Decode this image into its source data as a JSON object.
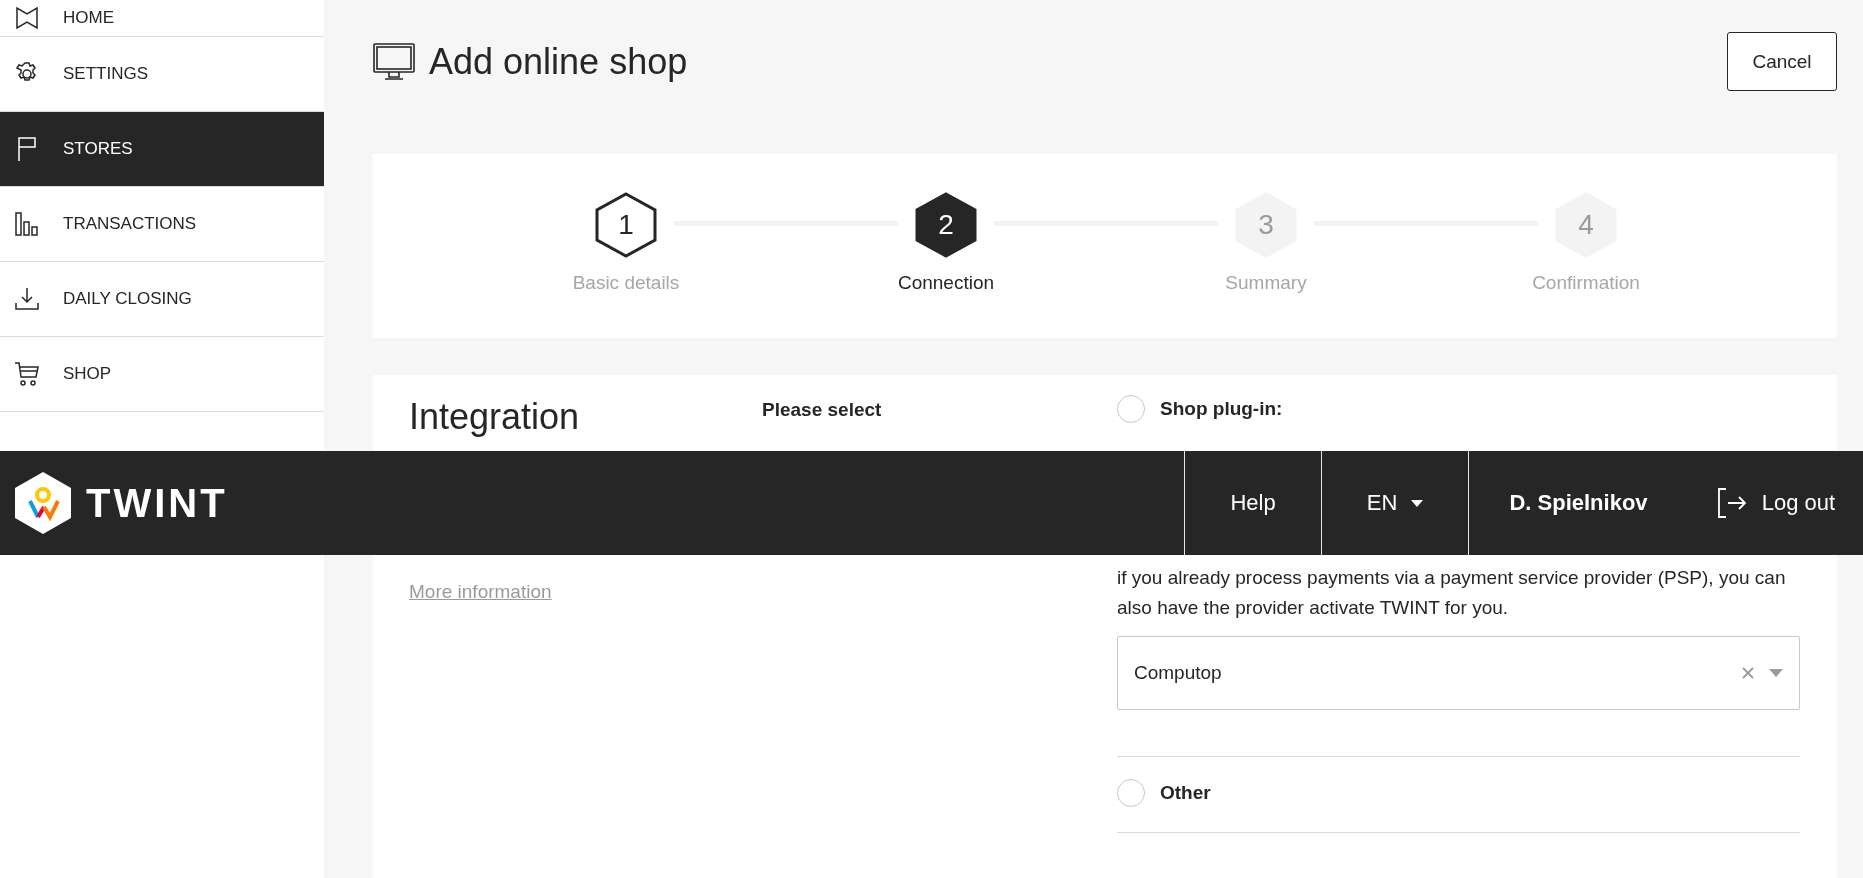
{
  "sidebar": {
    "items": [
      {
        "label": "HOME",
        "selected": false
      },
      {
        "label": "SETTINGS",
        "selected": false
      },
      {
        "label": "STORES",
        "selected": true
      },
      {
        "label": "TRANSACTIONS",
        "selected": false
      },
      {
        "label": "DAILY CLOSING",
        "selected": false
      },
      {
        "label": "SHOP",
        "selected": false
      }
    ]
  },
  "page": {
    "title": "Add online shop",
    "cancel": "Cancel"
  },
  "steps": [
    {
      "number": "1",
      "label": "Basic details",
      "done": true,
      "selected": false
    },
    {
      "number": "2",
      "label": "Connection",
      "done": false,
      "selected": true
    },
    {
      "number": "3",
      "label": "Summary",
      "done": false,
      "selected": false
    },
    {
      "number": "4",
      "label": "Confirmation",
      "done": false,
      "selected": false
    }
  ],
  "integration": {
    "title": "Integration",
    "more_link": "More information",
    "prompt": "Please select",
    "options": [
      {
        "label": "Shop plug-in:",
        "selected": false,
        "description": "if you already process payments via a payment service provider (PSP), you can also have the provider activate TWINT for you.",
        "select_value": "Computop"
      },
      {
        "label": "Other",
        "selected": false
      }
    ]
  },
  "header": {
    "logo_text": "TWINT",
    "help": "Help",
    "language": "EN",
    "user": "D. Spielnikov",
    "logout": "Log out"
  }
}
